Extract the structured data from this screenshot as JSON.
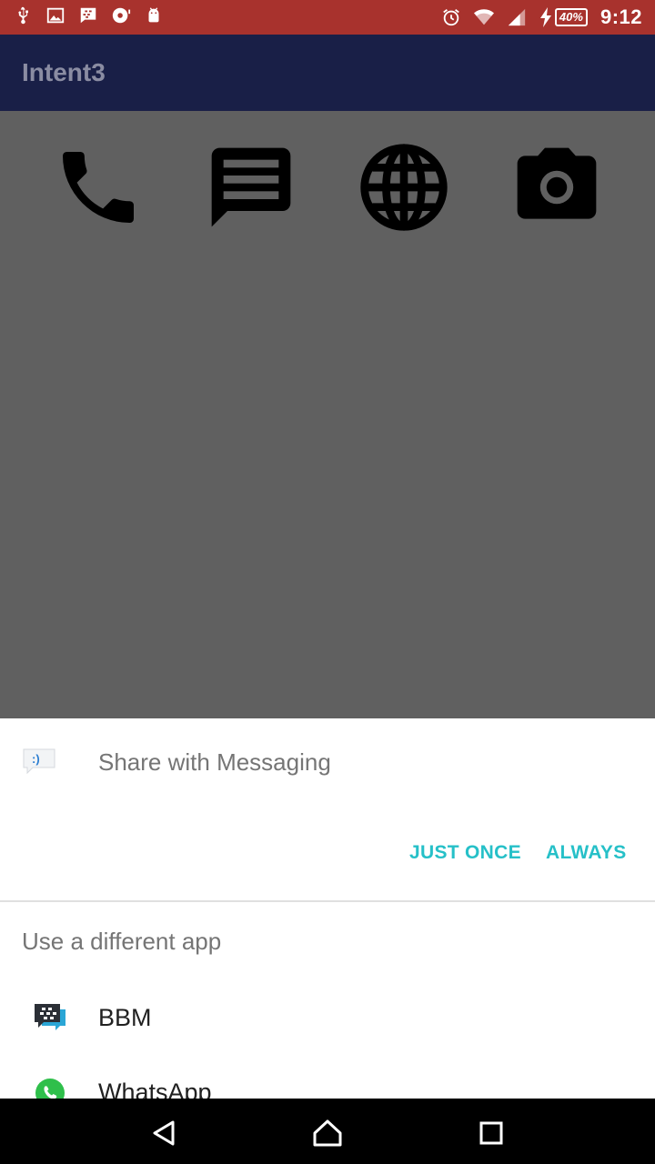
{
  "status_bar": {
    "time": "9:12",
    "battery": "40%",
    "left_icons": [
      "usb-icon",
      "image-icon",
      "bbm-notification-icon",
      "music-icon",
      "android-icon"
    ],
    "right_icons": [
      "alarm-icon",
      "wifi-icon",
      "signal-icon",
      "charging-icon",
      "battery-icon"
    ]
  },
  "app_bar": {
    "title": "Intent3"
  },
  "actions": [
    "phone-icon",
    "message-icon",
    "globe-icon",
    "camera-icon"
  ],
  "sheet": {
    "share_title": "Share with Messaging",
    "just_once": "JUST ONCE",
    "always": "ALWAYS",
    "different_app": "Use a different app",
    "apps": [
      {
        "label": "BBM",
        "icon": "bbm-icon"
      },
      {
        "label": "WhatsApp",
        "icon": "whatsapp-icon"
      }
    ]
  },
  "colors": {
    "status_bar": "#a8322d",
    "app_bar": "#191f47",
    "accent": "#26c0c8",
    "scrim": "#606060"
  }
}
